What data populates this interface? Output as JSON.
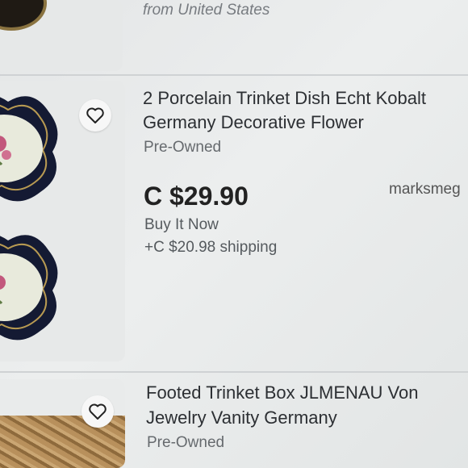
{
  "listings": [
    {
      "shipping_origin": "from United States"
    },
    {
      "title_line1": "2 Porcelain Trinket Dish Echt Kobalt",
      "title_line2": "Germany Decorative Flower",
      "condition": "Pre-Owned",
      "price": "C $29.90",
      "format": "Buy It Now",
      "shipping": "+C $20.98 shipping",
      "seller": "marksmeg"
    },
    {
      "title_line1": "Footed Trinket Box JLMENAU Von",
      "title_line2": "Jewelry Vanity Germany",
      "condition": "Pre-Owned"
    }
  ],
  "icons": {
    "favorite": "heart-icon"
  },
  "colors": {
    "plate_rim": "#141a33",
    "plate_center": "#e8eadc",
    "rose": "#c2587c"
  }
}
